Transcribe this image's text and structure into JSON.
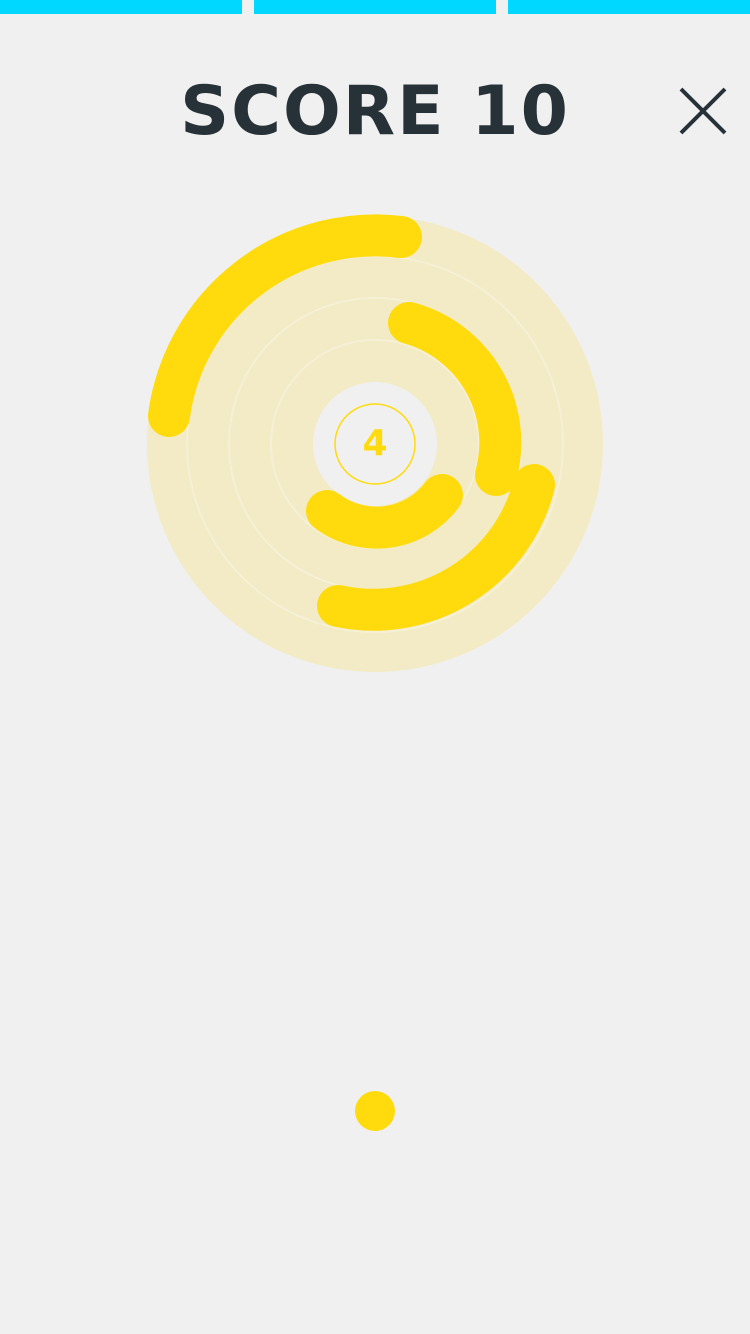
{
  "header": {
    "score_label": "SCORE 10",
    "close_icon": "close-icon"
  },
  "progress": {
    "segments": 3,
    "completed": 3,
    "color": "#00d8ff"
  },
  "game": {
    "level": "4",
    "ring_color": "#ffdb0d",
    "board_bg_color": "#f2ebc5",
    "center_bg_color": "#f0f0f0",
    "ball_color": "#ffdb0d",
    "rings": 4
  }
}
